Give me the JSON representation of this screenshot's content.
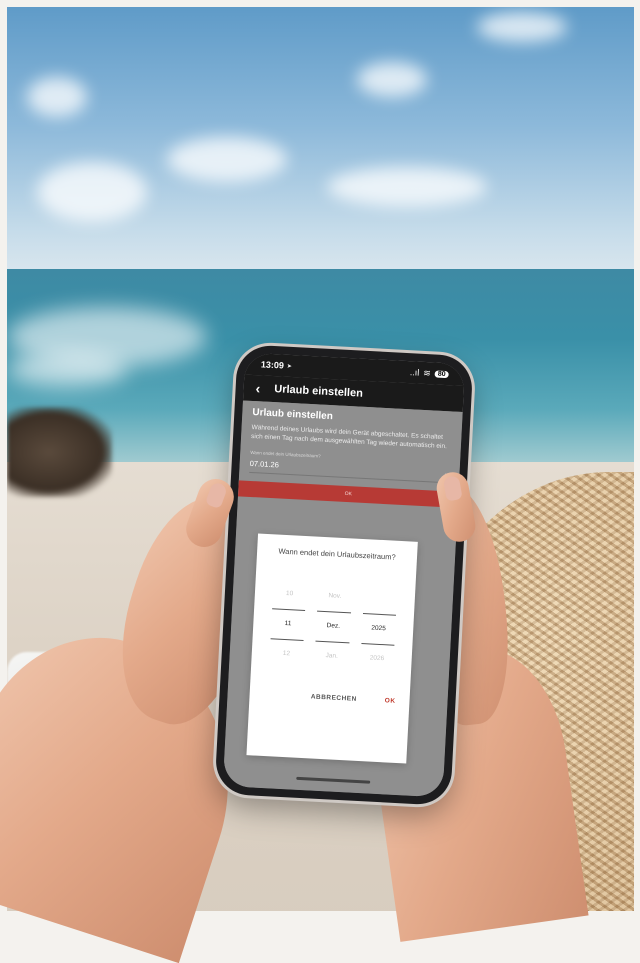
{
  "status_bar": {
    "time": "13:09",
    "location_glyph": "➤",
    "signal_glyph": "..ıl",
    "wifi_glyph": "≋",
    "battery": "80"
  },
  "nav": {
    "title": "Urlaub einstellen",
    "back_glyph": "‹"
  },
  "content": {
    "heading": "Urlaub einstellen",
    "description": "Während deines Urlaubs wird dein Gerät abgeschaltet. Es schaltet sich einen Tag nach dem ausgewählten Tag wieder automatisch ein.",
    "field_label": "Wann endet dein Urlaubszeitraum?",
    "field_value": "07.01.26",
    "field_chevron": "⌄",
    "ok_label": "OK"
  },
  "dialog": {
    "title": "Wann endet dein Urlaubszeitraum?",
    "columns": [
      {
        "above": "10",
        "selected": "11",
        "below": "12"
      },
      {
        "above": "Nov.",
        "selected": "Dez.",
        "below": "Jan."
      },
      {
        "above": "",
        "selected": "2025",
        "below": "2026"
      }
    ],
    "cancel_label": "ABBRECHEN",
    "ok_label": "OK"
  },
  "colors": {
    "accent": "#b73a35",
    "ok_text": "#c0392b"
  }
}
